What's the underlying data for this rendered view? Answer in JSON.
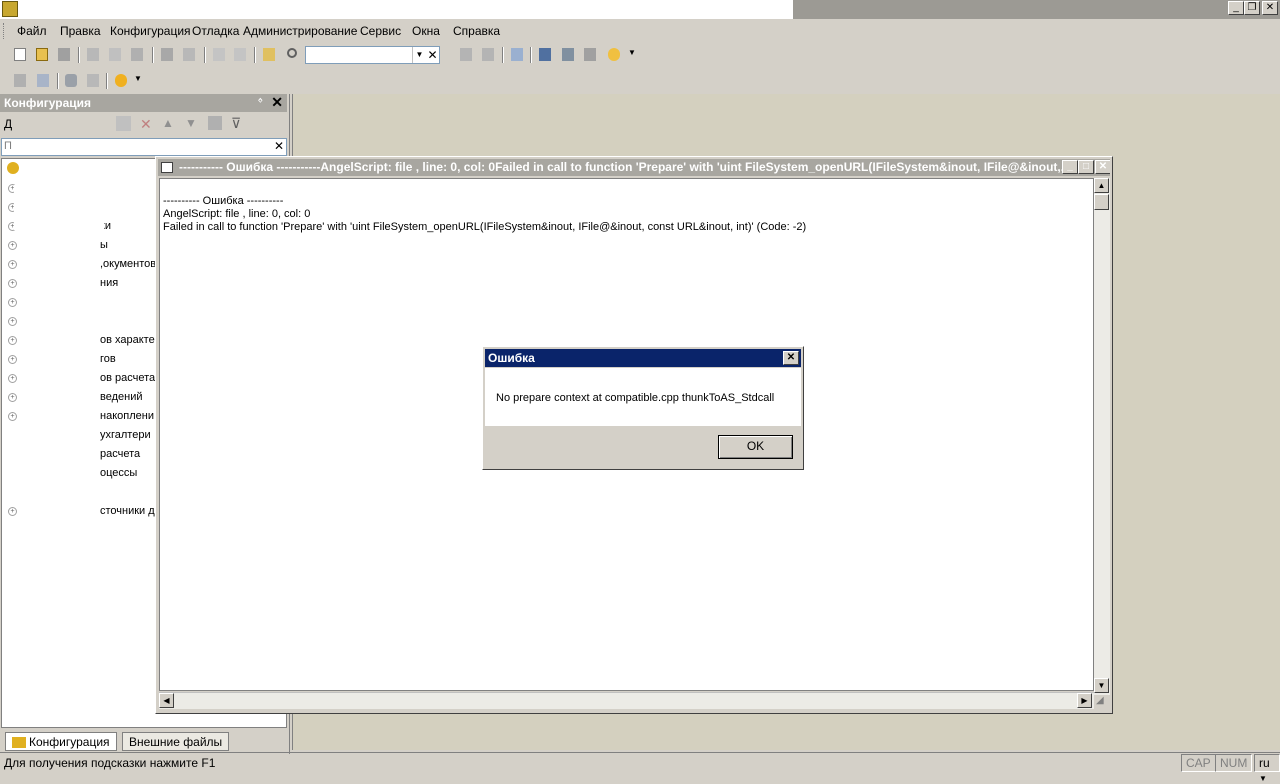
{
  "window": {
    "controls": [
      "_",
      "❐",
      "✕"
    ]
  },
  "menu": [
    {
      "label": "Файл"
    },
    {
      "label": "Правка"
    },
    {
      "label": "Конфигурация"
    },
    {
      "label": "Отладка"
    },
    {
      "label": "Администрирование"
    },
    {
      "label": "Сервис"
    },
    {
      "label": "Окна"
    },
    {
      "label": "Справка"
    }
  ],
  "left_panel": {
    "title": "Конфигурация",
    "filter_placeholder": "П",
    "tree_items": [
      "ки",
      "ы",
      ",окументов",
      "ния",
      "ов характе",
      "гов",
      "ов расчета",
      "ведений",
      "накоплени",
      "ухгалтери",
      "расчета",
      "оцессы",
      "сточники д"
    ],
    "tabs": [
      "Конфигурация",
      "Внешние файлы"
    ]
  },
  "error_window": {
    "title": "----------- Ошибка -----------AngelScript: file , line: 0, col: 0Failed in call to function 'Prepare' with 'uint FileSystem_openURL(IFileSystem&inout, IFile@&inout,...",
    "lines": [
      "---------- Ошибка ----------",
      "AngelScript: file , line: 0, col: 0",
      "Failed in call to function 'Prepare' with 'uint FileSystem_openURL(IFileSystem&inout, IFile@&inout, const URL&inout, int)' (Code: -2)"
    ]
  },
  "message_box": {
    "title": "Ошибка",
    "text": "No prepare context at compatible.cpp thunkToAS_Stdcall",
    "ok": "OK"
  },
  "status": {
    "hint": "Для получения подсказки нажмите F1",
    "cap": "CAP",
    "num": "NUM",
    "lang": "ru"
  }
}
